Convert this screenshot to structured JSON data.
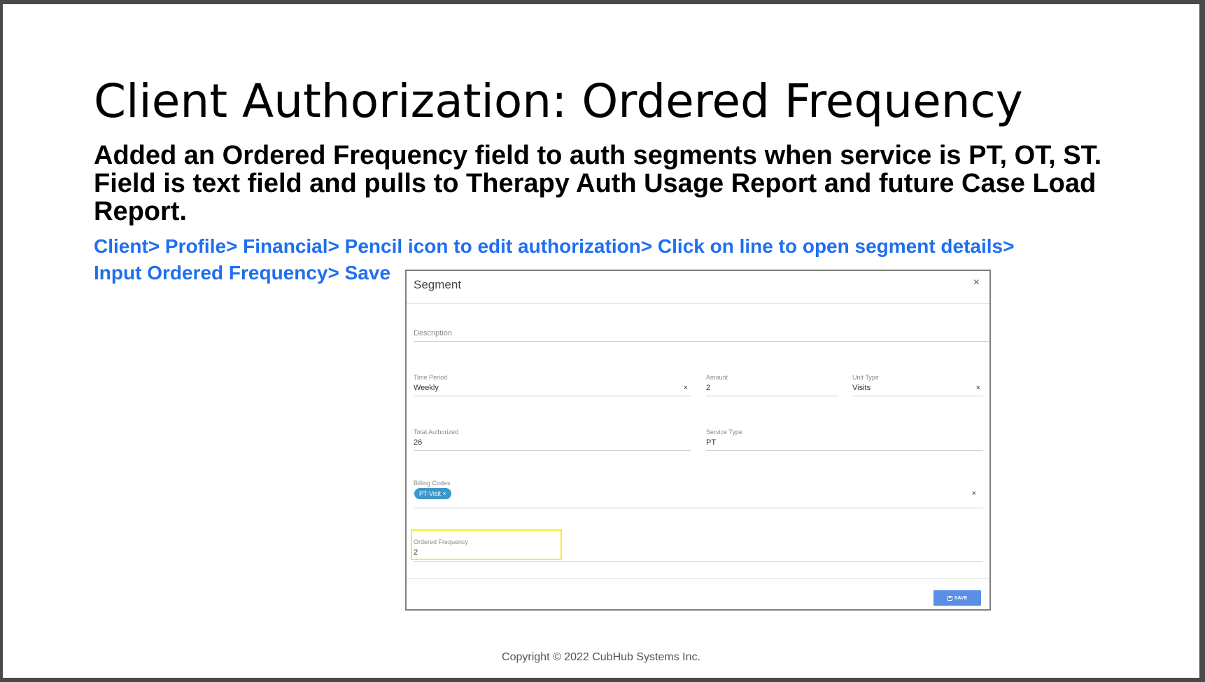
{
  "slide": {
    "title": "Client Authorization: Ordered Frequency",
    "subtitle": "Added an Ordered Frequency field to auth segments when service is PT, OT, ST. Field is text field and pulls to Therapy Auth Usage Report and future Case Load Report.",
    "path_line_1": "Client> Profile> Financial> Pencil icon to edit authorization> Click on line to open segment details>",
    "path_line_2": "Input Ordered Frequency> Save",
    "copyright": "Copyright © 2022 CubHub Systems Inc."
  },
  "modal": {
    "title": "Segment",
    "close_glyph": "×",
    "description_label": "Description",
    "time_period": {
      "label": "Time Period",
      "value": "Weekly",
      "clear": "×"
    },
    "amount": {
      "label": "Amount",
      "value": "2"
    },
    "unit_type": {
      "label": "Unit Type",
      "value": "Visits",
      "clear": "×"
    },
    "total_authorized": {
      "label": "Total Authorized",
      "value": "26"
    },
    "service_type": {
      "label": "Service Type",
      "value": "PT"
    },
    "billing_codes": {
      "label": "Billing Codes",
      "chip": "PT-Visit ×",
      "clear": "×"
    },
    "ordered_frequency": {
      "label": "Ordered Frequency",
      "value": "2"
    },
    "save_label": "SAVE"
  },
  "colors": {
    "path_link": "#1f6ff0",
    "chip": "#3d97c9",
    "highlight": "#f3ef2a",
    "save_button": "#5b8ee6"
  }
}
